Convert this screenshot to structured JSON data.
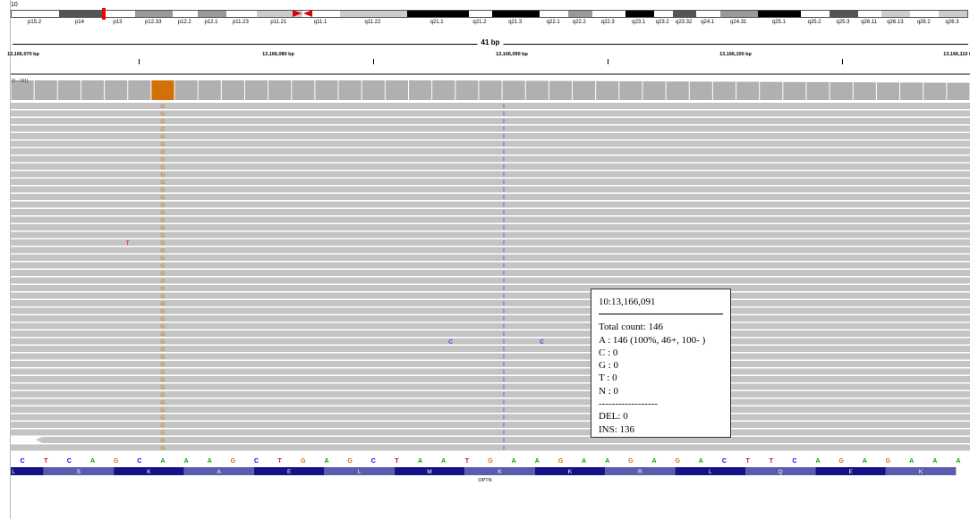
{
  "chromosome": {
    "name": "10"
  },
  "ideogram_bands": [
    {
      "label": "p15.2",
      "color": "#fff",
      "w": 50
    },
    {
      "label": "p14",
      "color": "#555",
      "w": 45
    },
    {
      "label": "p13",
      "color": "#fff",
      "w": 35
    },
    {
      "label": "p12.33",
      "color": "#999",
      "w": 40
    },
    {
      "label": "p12.2",
      "color": "#fff",
      "w": 26
    },
    {
      "label": "p12.1",
      "color": "#999",
      "w": 30
    },
    {
      "label": "p11.23",
      "color": "#fff",
      "w": 32
    },
    {
      "label": "p11.21",
      "color": "#ccc",
      "w": 48
    },
    {
      "label": "q11.1",
      "color": "#fff",
      "w": 40
    },
    {
      "label": "q11.22",
      "color": "#ccc",
      "w": 70
    },
    {
      "label": "q21.1",
      "color": "#000",
      "w": 65
    },
    {
      "label": "q21.2",
      "color": "#fff",
      "w": 25
    },
    {
      "label": "q21.3",
      "color": "#000",
      "w": 50
    },
    {
      "label": "q22.1",
      "color": "#fff",
      "w": 30
    },
    {
      "label": "q22.2",
      "color": "#999",
      "w": 25
    },
    {
      "label": "q22.3",
      "color": "#fff",
      "w": 35
    },
    {
      "label": "q23.1",
      "color": "#000",
      "w": 30
    },
    {
      "label": "q23.2",
      "color": "#fff",
      "w": 20
    },
    {
      "label": "q23.32",
      "color": "#555",
      "w": 25
    },
    {
      "label": "q24.1",
      "color": "#fff",
      "w": 25
    },
    {
      "label": "q24.31",
      "color": "#999",
      "w": 40
    },
    {
      "label": "q25.1",
      "color": "#000",
      "w": 45
    },
    {
      "label": "q25.2",
      "color": "#fff",
      "w": 30
    },
    {
      "label": "q25.3",
      "color": "#555",
      "w": 30
    },
    {
      "label": "q26.11",
      "color": "#fff",
      "w": 25
    },
    {
      "label": "q26.13",
      "color": "#ccc",
      "w": 30
    },
    {
      "label": "q26.2",
      "color": "#fff",
      "w": 30
    },
    {
      "label": "q26.3",
      "color": "#ccc",
      "w": 30
    }
  ],
  "ruler": {
    "span_label": "41 bp",
    "tick_labels": [
      "13,166,070 bp",
      "13,166,080 bp",
      "13,166,090 bp",
      "13,166,100 bp",
      "13,166,110 bp"
    ]
  },
  "coverage": {
    "range_label": "[0 - 191]"
  },
  "reads": {
    "row_count": 46,
    "mismatch_base": "G",
    "insertion_marker": "I",
    "stray_bases": [
      {
        "base": "T",
        "row": 18,
        "col": 4.5
      },
      {
        "base": "C",
        "row": 31,
        "col": 18.3
      },
      {
        "base": "C",
        "row": 31,
        "col": 22.2
      }
    ]
  },
  "reference": {
    "bases": [
      "C",
      "T",
      "C",
      "A",
      "G",
      "C",
      "A",
      "A",
      "A",
      "G",
      "C",
      "T",
      "G",
      "A",
      "G",
      "C",
      "T",
      "A",
      "A",
      "T",
      "G",
      "A",
      "A",
      "G",
      "A",
      "A",
      "G",
      "A",
      "G",
      "A",
      "C",
      "T",
      "T",
      "C",
      "A",
      "G",
      "A",
      "G",
      "A",
      "A",
      "A"
    ]
  },
  "amino_acids": [
    "L",
    "S",
    "K",
    "A",
    "E",
    "L",
    "M",
    "K",
    "K",
    "R",
    "L",
    "Q",
    "E",
    "K"
  ],
  "gene": {
    "name": "OPTN"
  },
  "popup": {
    "position": "10:13,166,091",
    "total": "Total count: 146",
    "a": "A : 146 (100%, 46+, 100- )",
    "c": "C : 0",
    "g": "G : 0",
    "t": "T : 0",
    "n": "N : 0",
    "separator": "------------------",
    "del": "DEL: 0",
    "ins": "INS: 136"
  },
  "colors": {
    "A": "#00a000",
    "C": "#0000e0",
    "G": "#d17105",
    "T": "#e00000",
    "insertion": "#6a1bd1",
    "read": "#c4c4c4"
  }
}
